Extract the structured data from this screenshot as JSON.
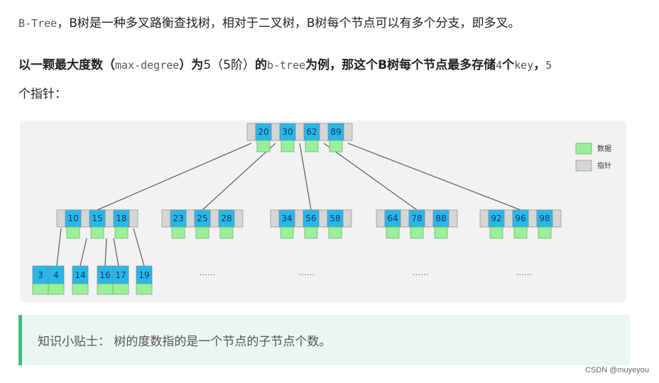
{
  "paragraphs": {
    "p1": {
      "code": "B-Tree",
      "sep": "，",
      "text_a": "B树是一种多叉路衡查找树，相对于二叉树，",
      "text_b": "B树每个节点可以有多个分支，即多叉。"
    },
    "p2": {
      "a": "以一颗最大度数（",
      "b": "max-degree",
      "c": "）为",
      "d": "5（5阶）",
      "e": "的",
      "f": "b-tree",
      "g": "为例，那这个",
      "h": "B树每个节点最多存储",
      "i": "4",
      "j": "个",
      "k": "key",
      "l": "，",
      "m": "5"
    },
    "p3": "个指针："
  },
  "diagram": {
    "colors": {
      "key": "#27b7eb",
      "data": "#9af09a",
      "pointer": "#d6d6d6",
      "line": "#666666"
    },
    "root": {
      "keys": [
        "20",
        "30",
        "62",
        "89"
      ]
    },
    "level2": [
      {
        "keys": [
          "10",
          "15",
          "18"
        ]
      },
      {
        "keys": [
          "23",
          "25",
          "28"
        ]
      },
      {
        "keys": [
          "34",
          "56",
          "58"
        ]
      },
      {
        "keys": [
          "64",
          "78",
          "88"
        ]
      },
      {
        "keys": [
          "92",
          "96",
          "98"
        ]
      }
    ],
    "leaves": [
      {
        "keys": [
          "3",
          "4"
        ]
      },
      {
        "keys": [
          "14"
        ]
      },
      {
        "keys": [
          "16",
          "17"
        ]
      },
      {
        "keys": [
          "19"
        ]
      }
    ],
    "ellipsis": "......",
    "legend": {
      "data_label": "数据",
      "pointer_label": "指针"
    }
  },
  "tip": "知识小贴士： 树的度数指的是一个节点的子节点个数。",
  "watermark": "CSDN @muyeyou"
}
